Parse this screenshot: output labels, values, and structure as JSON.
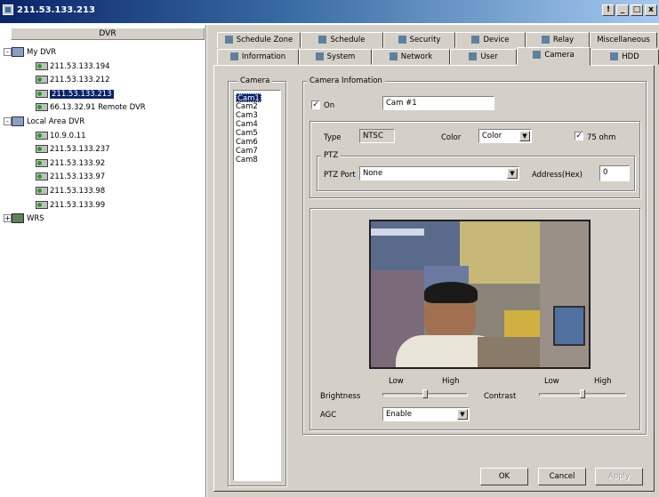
{
  "window": {
    "title": "211.53.133.213",
    "buttons": [
      "!",
      "_",
      "□",
      "x"
    ]
  },
  "tree": {
    "header": "DVR",
    "nodes": [
      {
        "label": "My DVR",
        "level": 0,
        "type": "group",
        "expander": "-"
      },
      {
        "label": "211.53.133.194",
        "level": 1,
        "type": "dvr"
      },
      {
        "label": "211.53.133.212",
        "level": 1,
        "type": "dvr"
      },
      {
        "label": "211.53.133.213",
        "level": 1,
        "type": "dvr",
        "selected": true
      },
      {
        "label": "66.13.32.91 Remote DVR",
        "level": 1,
        "type": "dvr"
      },
      {
        "label": "Local Area DVR",
        "level": 0,
        "type": "group",
        "expander": "-"
      },
      {
        "label": "10.9.0.11",
        "level": 1,
        "type": "dvr"
      },
      {
        "label": "211.53.133.237",
        "level": 1,
        "type": "dvr"
      },
      {
        "label": "211.53.133.92",
        "level": 1,
        "type": "dvr"
      },
      {
        "label": "211.53.133.97",
        "level": 1,
        "type": "dvr"
      },
      {
        "label": "211.53.133.98",
        "level": 1,
        "type": "dvr"
      },
      {
        "label": "211.53.133.99",
        "level": 1,
        "type": "dvr"
      },
      {
        "label": "WRS",
        "level": 0,
        "type": "wrs",
        "expander": "+"
      }
    ]
  },
  "tabs_row1": [
    "Schedule Zone",
    "Schedule",
    "Security",
    "Device",
    "Relay",
    "Miscellaneous"
  ],
  "tabs_row2": [
    "Information",
    "System",
    "Network",
    "User",
    "Camera",
    "HDD"
  ],
  "active_tab": "Camera",
  "camera_group": {
    "title": "Camera",
    "items": [
      "Cam1",
      "Cam2",
      "Cam3",
      "Cam4",
      "Cam5",
      "Cam6",
      "Cam7",
      "Cam8"
    ],
    "selected": "Cam1"
  },
  "camera_info": {
    "title": "Camera Infomation",
    "on_label": "On",
    "on_checked": true,
    "name_value": "Cam #1",
    "type_label": "Type",
    "type_value": "NTSC",
    "color_label": "Color",
    "color_value": "Color",
    "ohm_label": "75 ohm",
    "ohm_checked": true
  },
  "ptz": {
    "title": "PTZ",
    "port_label": "PTZ Port",
    "port_value": "None",
    "address_label": "Address(Hex)",
    "address_value": "0"
  },
  "adjust": {
    "brightness_label": "Brightness",
    "brightness_low": "Low",
    "brightness_high": "High",
    "brightness_level": 0.5,
    "contrast_label": "Contrast",
    "contrast_low": "Low",
    "contrast_high": "High",
    "contrast_level": 0.5,
    "agc_label": "AGC",
    "agc_value": "Enable"
  },
  "buttons": {
    "ok": "OK",
    "cancel": "Cancel",
    "apply": "Apply"
  }
}
